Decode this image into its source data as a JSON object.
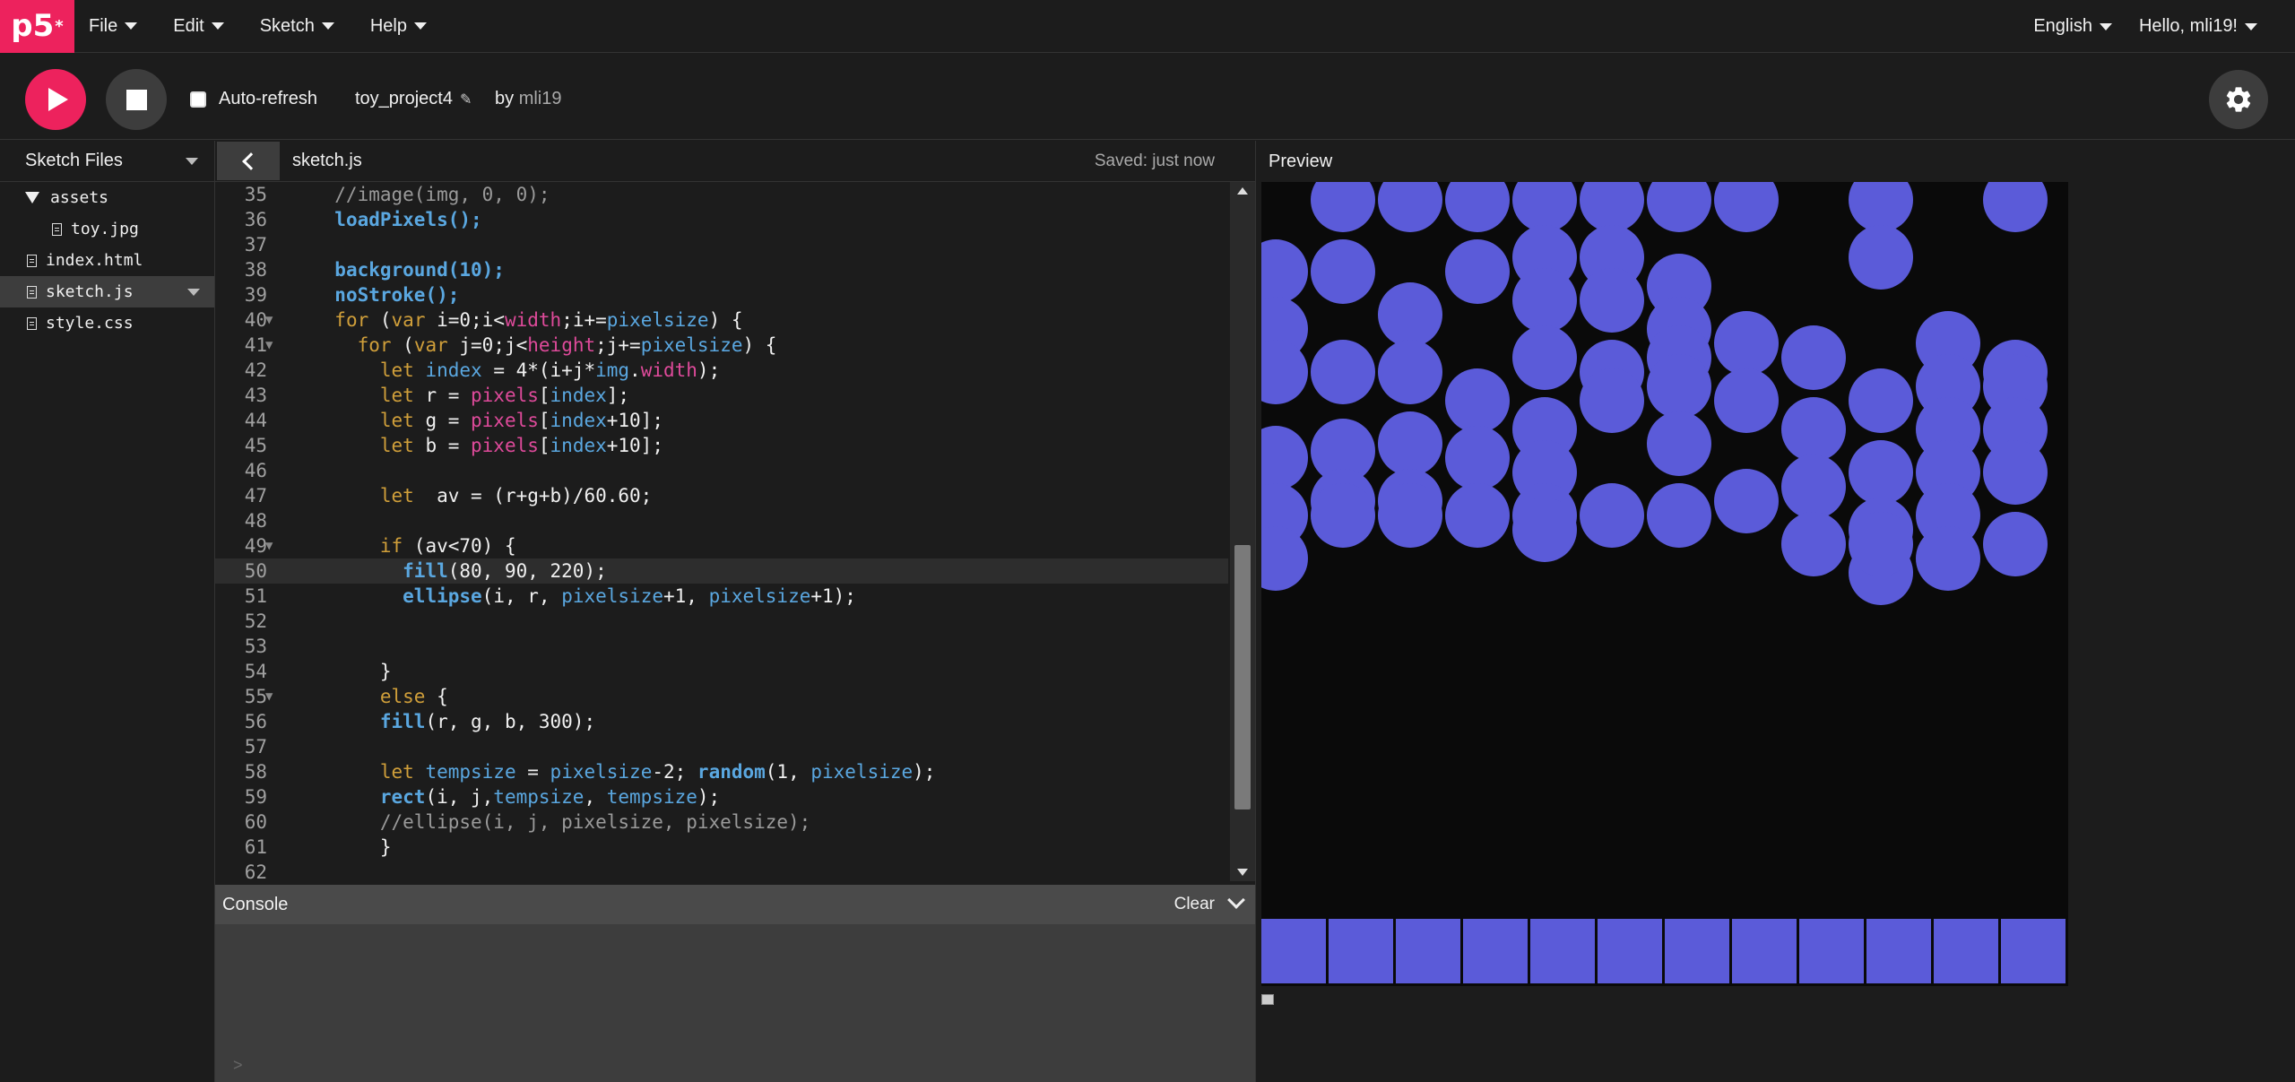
{
  "topbar": {
    "logo": "p5",
    "logo_sup": "*",
    "menu": [
      "File",
      "Edit",
      "Sketch",
      "Help"
    ],
    "language": "English",
    "greeting": "Hello, mli19!"
  },
  "toolbar": {
    "auto_refresh_label": "Auto-refresh",
    "auto_refresh_checked": false,
    "project_name": "toy_project4",
    "by_label": "by",
    "author": "mli19"
  },
  "sidebar": {
    "title": "Sketch Files",
    "files": [
      {
        "name": "assets",
        "type": "folder"
      },
      {
        "name": "toy.jpg",
        "type": "file"
      },
      {
        "name": "index.html",
        "type": "file"
      },
      {
        "name": "sketch.js",
        "type": "file",
        "selected": true
      },
      {
        "name": "style.css",
        "type": "file"
      }
    ]
  },
  "editor": {
    "tab_name": "sketch.js",
    "saved_status": "Saved: just now",
    "lines": [
      {
        "n": "35",
        "text": "  //image(img, 0, 0);"
      },
      {
        "n": "36",
        "text": "  loadPixels();"
      },
      {
        "n": "37",
        "text": ""
      },
      {
        "n": "38",
        "text": "  background(10);"
      },
      {
        "n": "39",
        "text": "  noStroke();"
      },
      {
        "n": "40",
        "text": "  for (var i=0;i<width;i+=pixelsize) {"
      },
      {
        "n": "41",
        "text": "    for (var j=0;j<height;j+=pixelsize) {"
      },
      {
        "n": "42",
        "text": "      let index = 4*(i+j*img.width);"
      },
      {
        "n": "43",
        "text": "      let r = pixels[index];"
      },
      {
        "n": "44",
        "text": "      let g = pixels[index+10];"
      },
      {
        "n": "45",
        "text": "      let b = pixels[index+10];"
      },
      {
        "n": "46",
        "text": ""
      },
      {
        "n": "47",
        "text": "      let  av = (r+g+b)/60.60;"
      },
      {
        "n": "48",
        "text": ""
      },
      {
        "n": "49",
        "text": "      if (av<70) {"
      },
      {
        "n": "50",
        "text": "        fill(80, 90, 220);"
      },
      {
        "n": "51",
        "text": "        ellipse(i, r, pixelsize+1, pixelsize+1);"
      },
      {
        "n": "52",
        "text": ""
      },
      {
        "n": "53",
        "text": ""
      },
      {
        "n": "54",
        "text": "      }"
      },
      {
        "n": "55",
        "text": "      else {"
      },
      {
        "n": "56",
        "text": "      fill(r, g, b, 300);"
      },
      {
        "n": "57",
        "text": ""
      },
      {
        "n": "58",
        "text": "      let tempsize = pixelsize-2; random(1, pixelsize);"
      },
      {
        "n": "59",
        "text": "      rect(i, j,tempsize, tempsize);"
      },
      {
        "n": "60",
        "text": "      //ellipse(i, j, pixelsize, pixelsize);"
      },
      {
        "n": "61",
        "text": "      }"
      },
      {
        "n": "62",
        "text": ""
      }
    ]
  },
  "console": {
    "title": "Console",
    "clear_label": "Clear",
    "prompt": ">"
  },
  "preview": {
    "title": "Preview",
    "fill_color": "#5b5bd9",
    "background_color": "#0a0a0a"
  }
}
